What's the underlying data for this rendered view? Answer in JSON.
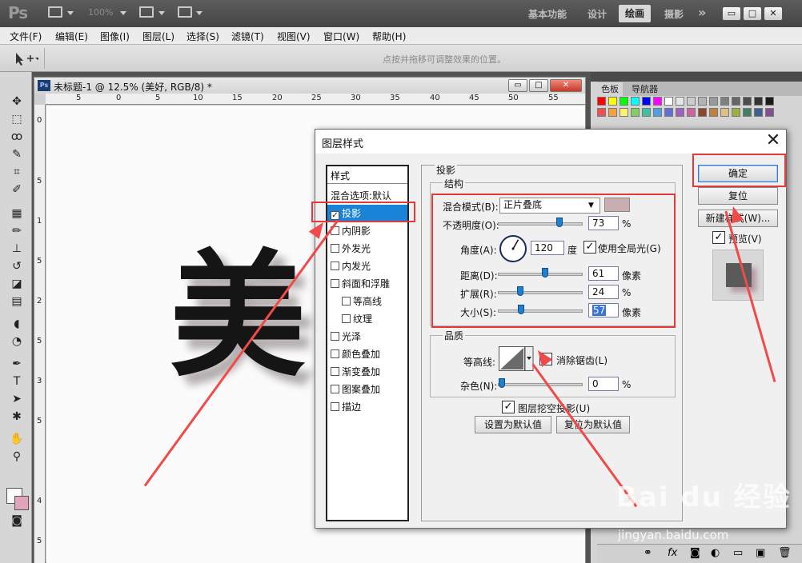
{
  "app": {
    "logo": "Ps",
    "zoom_value": "100%",
    "workspaces": [
      "基本功能",
      "设计",
      "绘画",
      "摄影"
    ],
    "active_workspace": "绘画",
    "more_glyph": "»",
    "window_buttons": [
      "▭",
      "□",
      "✕"
    ]
  },
  "menus": [
    "文件(F)",
    "编辑(E)",
    "图像(I)",
    "图层(L)",
    "选择(S)",
    "滤镜(T)",
    "视图(V)",
    "窗口(W)",
    "帮助(H)"
  ],
  "options": {
    "hint": "点按并拖移可调整效果的位置。"
  },
  "document": {
    "title": "未标题-1 @ 12.5% (美好, RGB/8) *",
    "ps_badge": "Ps",
    "ruler_h": [
      "5",
      "0",
      "5",
      "10",
      "15",
      "20",
      "25",
      "30",
      "35",
      "40",
      "45",
      "50",
      "55"
    ],
    "ruler_v": [
      "0",
      "5",
      "1",
      "5",
      "2",
      "5",
      "3",
      "5",
      "4",
      "5"
    ],
    "canvas_text": "美"
  },
  "panel": {
    "tabs": [
      "色板",
      "导航器"
    ],
    "swatch_colors": [
      "#ff0000",
      "#ffff00",
      "#00ff00",
      "#00ffff",
      "#0000ff",
      "#ff00ff",
      "#ffffff",
      "#e6e6e6",
      "#cccccc",
      "#b3b3b3",
      "#999999",
      "#808080",
      "#666666",
      "#4d4d4d",
      "#333333",
      "#1a1a1a",
      "#f05050",
      "#f7a040",
      "#fff070",
      "#80d060",
      "#40c0a0",
      "#50a0e0",
      "#6070d0",
      "#a060c0",
      "#d060a0",
      "#8a4a2a",
      "#c08040",
      "#e0c080",
      "#a0b040",
      "#408060",
      "#406090",
      "#805090"
    ]
  },
  "dialog": {
    "title": "图层样式",
    "close": "✕",
    "styles_header": "样式",
    "blend_defaults": "混合选项:默认",
    "items": [
      {
        "label": "投影",
        "checked": true,
        "selected": true
      },
      {
        "label": "内阴影",
        "checked": false
      },
      {
        "label": "外发光",
        "checked": false
      },
      {
        "label": "内发光",
        "checked": false
      },
      {
        "label": "斜面和浮雕",
        "checked": false
      },
      {
        "label": "等高线",
        "checked": false,
        "indent": true
      },
      {
        "label": "纹理",
        "checked": false,
        "indent": true
      },
      {
        "label": "光泽",
        "checked": false
      },
      {
        "label": "颜色叠加",
        "checked": false
      },
      {
        "label": "渐变叠加",
        "checked": false
      },
      {
        "label": "图案叠加",
        "checked": false
      },
      {
        "label": "描边",
        "checked": false
      }
    ],
    "section_title": "投影",
    "structure_title": "结构",
    "blend_mode_label": "混合模式(B):",
    "blend_mode_value": "正片叠底",
    "shadow_color": "#c9aeb1",
    "opacity_label": "不透明度(O):",
    "opacity_value": "73",
    "opacity_unit": "%",
    "opacity_fraction": 0.73,
    "angle_label": "角度(A):",
    "angle_value": "120",
    "angle_unit": "度",
    "global_light_label": "使用全局光(G)",
    "distance_label": "距离(D):",
    "distance_value": "61",
    "distance_unit": "像素",
    "distance_fraction": 0.55,
    "spread_label": "扩展(R):",
    "spread_value": "24",
    "spread_unit": "%",
    "spread_fraction": 0.24,
    "size_label": "大小(S):",
    "size_value": "57",
    "size_unit": "像素",
    "size_fraction": 0.25,
    "quality_title": "品质",
    "contour_label": "等高线:",
    "antialias_label": "消除锯齿(L)",
    "noise_label": "杂色(N):",
    "noise_value": "0",
    "noise_unit": "%",
    "knockout_label": "图层挖空投影(U)",
    "set_default": "设置为默认值",
    "reset_default": "复位为默认值",
    "ok": "确定",
    "reset": "复位",
    "new_style": "新建样式(W)...",
    "preview_label": "预览(V)"
  },
  "watermark": {
    "brand": "Bai du 经验",
    "url": "jingyan.baidu.com"
  }
}
